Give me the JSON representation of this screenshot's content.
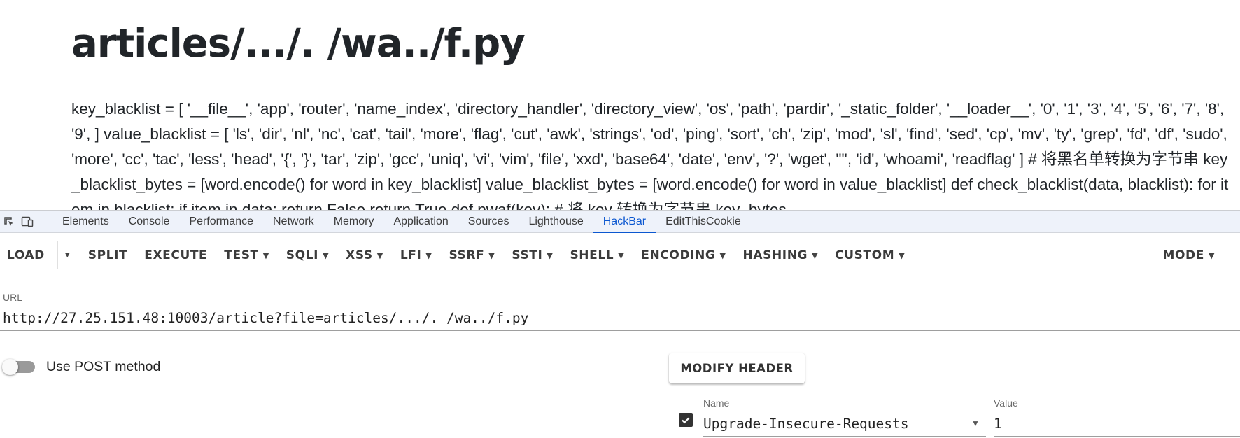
{
  "page": {
    "title": "articles/.../. /wa../f.py",
    "body": "key_blacklist = [ '__file__', 'app', 'router', 'name_index', 'directory_handler', 'directory_view', 'os', 'path', 'pardir', '_static_folder', '__loader__', '0', '1', '3', '4', '5', '6', '7', '8', '9', ] value_blacklist = [ 'ls', 'dir', 'nl', 'nc', 'cat', 'tail', 'more', 'flag', 'cut', 'awk', 'strings', 'od', 'ping', 'sort', 'ch', 'zip', 'mod', 'sl', 'find', 'sed', 'cp', 'mv', 'ty', 'grep', 'fd', 'df', 'sudo', 'more', 'cc', 'tac', 'less', 'head', '{', '}', 'tar', 'zip', 'gcc', 'uniq', 'vi', 'vim', 'file', 'xxd', 'base64', 'date', 'env', '?', 'wget', '\"', 'id', 'whoami', 'readflag' ] # 将黑名单转换为字节串 key_blacklist_bytes = [word.encode() for word in key_blacklist] value_blacklist_bytes = [word.encode() for word in value_blacklist] def check_blacklist(data, blacklist): for item in blacklist: if item in data: return False return True def pwaf(key): # 将 key 转换为字节串 key_bytes"
  },
  "devtools": {
    "tabs": [
      {
        "label": "Elements"
      },
      {
        "label": "Console"
      },
      {
        "label": "Performance"
      },
      {
        "label": "Network"
      },
      {
        "label": "Memory"
      },
      {
        "label": "Application"
      },
      {
        "label": "Sources"
      },
      {
        "label": "Lighthouse"
      },
      {
        "label": "HackBar",
        "active": true
      },
      {
        "label": "EditThisCookie"
      }
    ],
    "icons": [
      "inspect-element-icon",
      "device-toolbar-icon"
    ],
    "accent_color": "#0b57d0"
  },
  "hackbar": {
    "toolbar": {
      "load": "LOAD",
      "split": "SPLIT",
      "execute": "EXECUTE",
      "test": "TEST",
      "sqli": "SQLI",
      "xss": "XSS",
      "lfi": "LFI",
      "ssrf": "SSRF",
      "ssti": "SSTI",
      "shell": "SHELL",
      "encoding": "ENCODING",
      "hashing": "HASHING",
      "custom": "CUSTOM",
      "mode": "MODE"
    },
    "url": {
      "label": "URL",
      "value": "http://27.25.151.48:10003/article?file=articles/.../. /wa../f.py"
    },
    "post": {
      "label": "Use POST method",
      "enabled": false
    },
    "modify_header": {
      "button": "MODIFY HEADER",
      "headers": [
        {
          "enabled": true,
          "name_label": "Name",
          "name": "Upgrade-Insecure-Requests",
          "value_label": "Value",
          "value": "1"
        }
      ]
    }
  }
}
